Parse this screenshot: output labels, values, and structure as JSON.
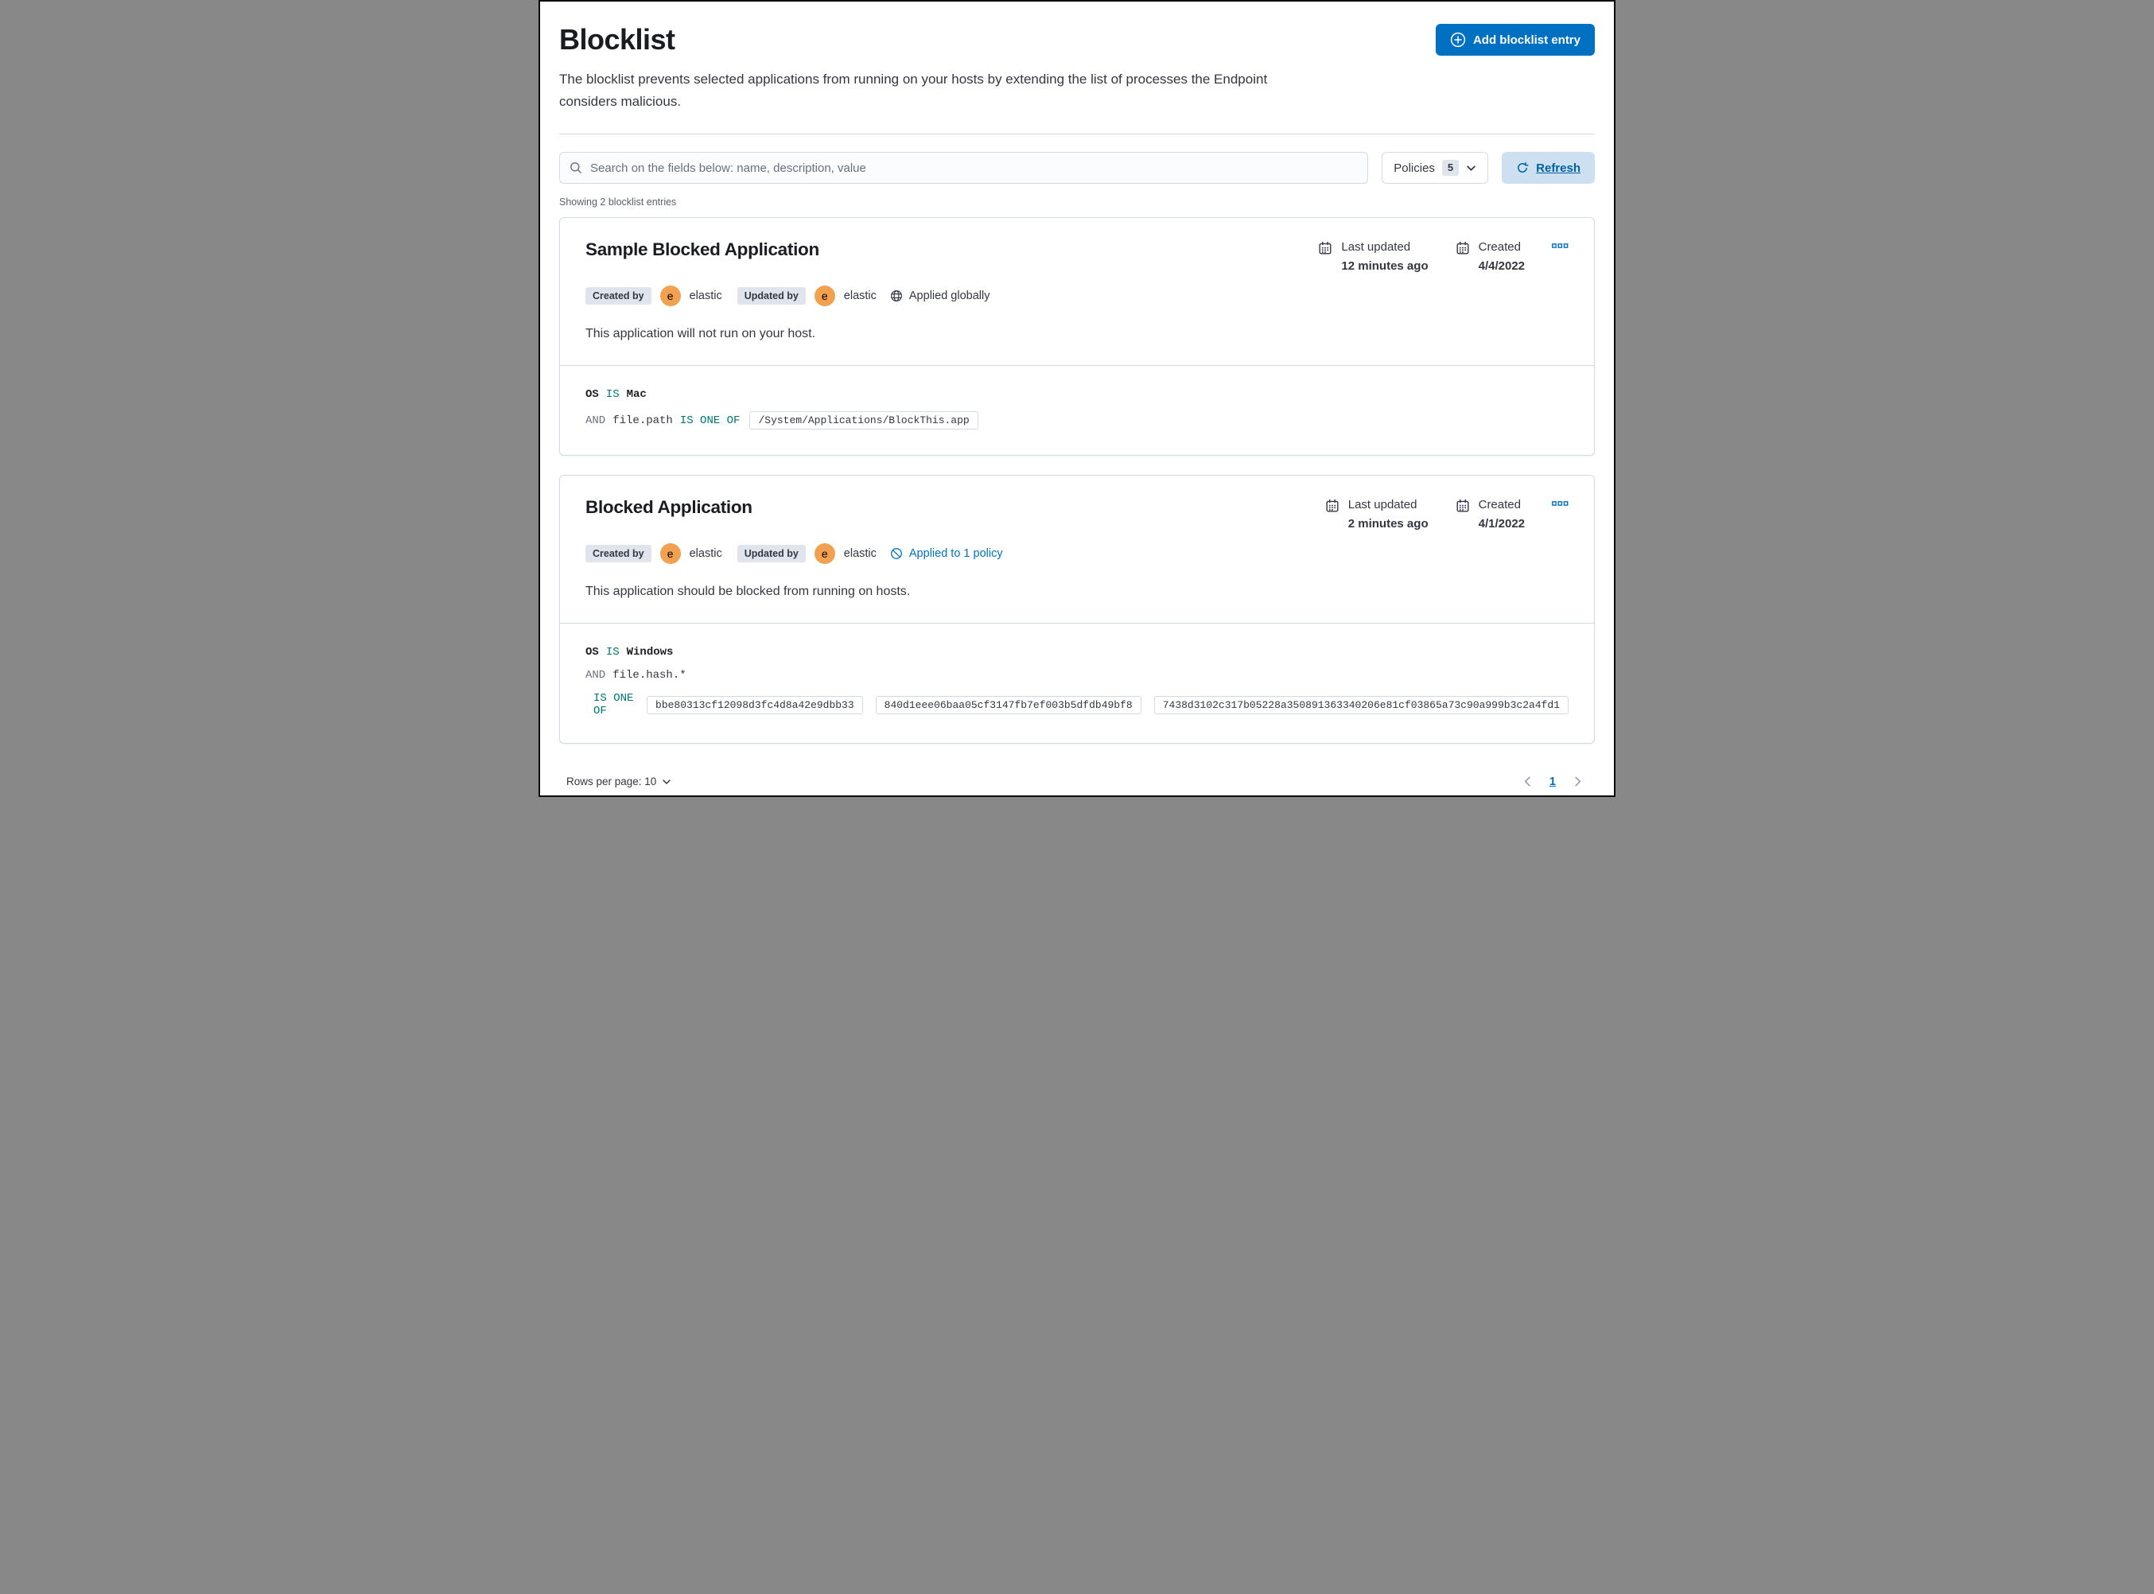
{
  "header": {
    "title": "Blocklist",
    "description": "The blocklist prevents selected applications from running on your hosts by extending the list of processes the Endpoint considers malicious.",
    "add_button": "Add blocklist entry"
  },
  "toolbar": {
    "search_placeholder": "Search on the fields below: name, description, value",
    "policies_label": "Policies",
    "policies_count": "5",
    "refresh_label": "Refresh"
  },
  "summary": "Showing 2 blocklist entries",
  "card_labels": {
    "created_by": "Created by",
    "updated_by": "Updated by",
    "last_updated": "Last updated",
    "created": "Created"
  },
  "entries": [
    {
      "title": "Sample Blocked Application",
      "avatar_initial": "e",
      "author": "elastic",
      "editor": "elastic",
      "scope_label": "Applied globally",
      "last_updated": "12 minutes ago",
      "created": "4/4/2022",
      "description": "This application will not run on your host.",
      "criteria": {
        "os_field": "OS",
        "os_operator": "IS",
        "os_value": "Mac",
        "conditions": [
          {
            "conjunction": "AND",
            "field": "file.path",
            "operator": "IS ONE OF",
            "values": [
              "/System/Applications/BlockThis.app"
            ]
          }
        ]
      }
    },
    {
      "title": "Blocked Application",
      "avatar_initial": "e",
      "author": "elastic",
      "editor": "elastic",
      "scope_label": "Applied to 1 policy",
      "last_updated": "2 minutes ago",
      "created": "4/1/2022",
      "description": "This application should be blocked from running on hosts.",
      "criteria": {
        "os_field": "OS",
        "os_operator": "IS",
        "os_value": "Windows",
        "conditions": [
          {
            "conjunction": "AND",
            "field": "file.hash.*",
            "operator": "IS ONE OF",
            "values": [
              "bbe80313cf12098d3fc4d8a42e9dbb33",
              "840d1eee06baa05cf3147fb7ef003b5dfdb49bf8",
              "7438d3102c317b05228a350891363340206e81cf03865a73c90a999b3c2a4fd1"
            ]
          }
        ]
      }
    }
  ],
  "footer": {
    "rows_per_page": "Rows per page: 10",
    "page_number": "1"
  },
  "colors": {
    "primary_blue": "#0071C2",
    "refresh_bg": "#CCE0F2",
    "operator_teal": "#007871",
    "conjunction_gray": "#69707D",
    "badge_bg": "#E0E4ED",
    "avatar_orange": "#F1A14F",
    "border_gray": "#D3DAE6",
    "text_dark": "#343741",
    "title_dark": "#1A1C21"
  }
}
